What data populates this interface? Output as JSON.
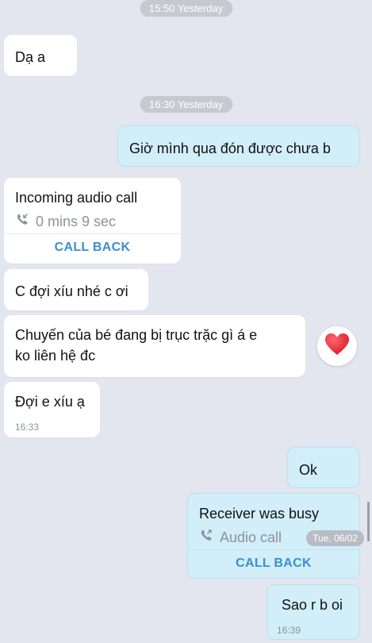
{
  "dividers": [
    {
      "label": "15:50 Yesterday"
    },
    {
      "label": "16:30 Yesterday"
    }
  ],
  "messages": {
    "m1": {
      "text": "Dạ a"
    },
    "m2": {
      "text": "Giờ mình qua đón được chưa b"
    },
    "call_in": {
      "title": "Incoming audio call",
      "duration": "0 mins 9 sec",
      "action": "CALL BACK"
    },
    "m3": {
      "text": "C đợi xíu nhé c ơi"
    },
    "m4": {
      "line1": "Chuyến của bé đang bị trục trặc gì á e",
      "line2": "ko liên hệ đc",
      "reaction": "heart"
    },
    "m5": {
      "text": "Đợi e xíu ạ",
      "time": "16:33"
    },
    "m6": {
      "text": "Ok"
    },
    "call_out": {
      "title": "Receiver was busy",
      "subtitle": "Audio call",
      "action": "CALL BACK"
    },
    "m7": {
      "text": "Sao r b oi",
      "time": "16:39"
    }
  },
  "date_chip": "Tue, 06/02",
  "colors": {
    "background": "#e3e6ee",
    "incoming_bubble": "#ffffff",
    "outgoing_bubble": "#d2eef9",
    "accent": "#3a8fd0",
    "muted": "#8e939b",
    "reaction": "#e0202e"
  }
}
